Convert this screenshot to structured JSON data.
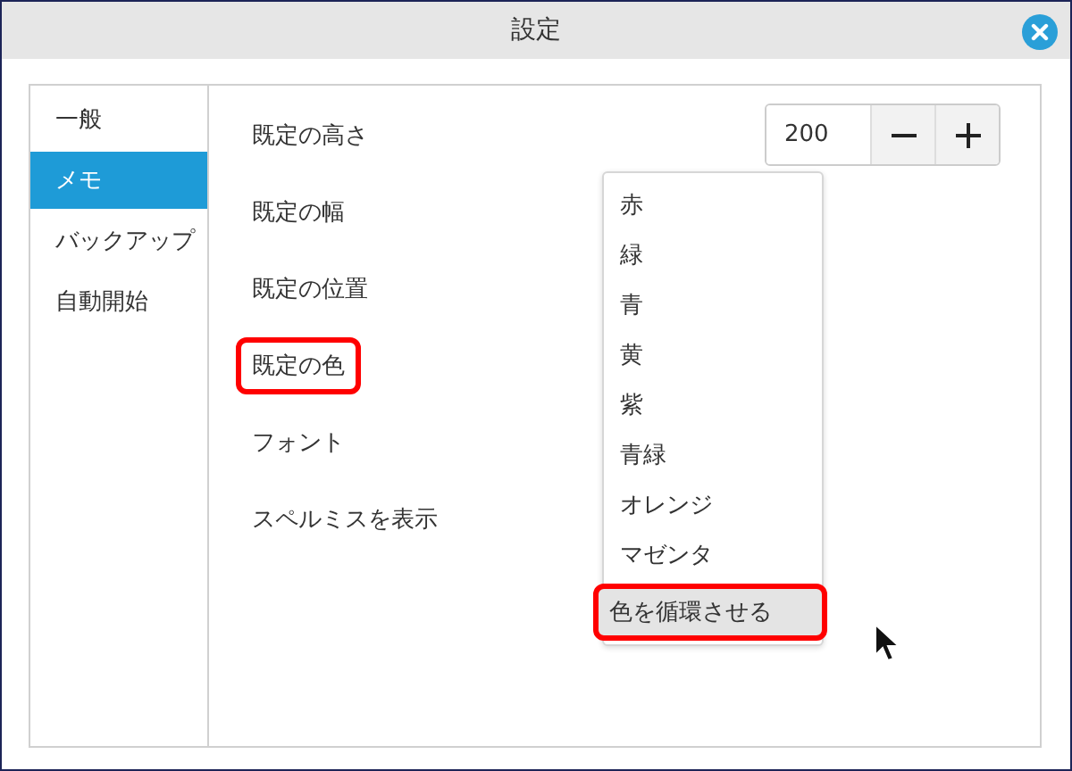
{
  "window": {
    "title": "設定"
  },
  "sidebar": {
    "items": [
      {
        "label": "一般",
        "selected": false
      },
      {
        "label": "メモ",
        "selected": true
      },
      {
        "label": "バックアップ",
        "selected": false
      },
      {
        "label": "自動開始",
        "selected": false
      }
    ]
  },
  "settings": [
    {
      "label": "既定の高さ",
      "highlighted": false
    },
    {
      "label": "既定の幅",
      "highlighted": false
    },
    {
      "label": "既定の位置",
      "highlighted": false
    },
    {
      "label": "既定の色",
      "highlighted": true
    },
    {
      "label": "フォント",
      "highlighted": false
    },
    {
      "label": "スペルミスを表示",
      "highlighted": false
    }
  ],
  "height_spinner": {
    "value": "200"
  },
  "color_menu": {
    "items": [
      {
        "label": "赤",
        "selected": false,
        "highlighted": false
      },
      {
        "label": "緑",
        "selected": false,
        "highlighted": false
      },
      {
        "label": "青",
        "selected": false,
        "highlighted": false
      },
      {
        "label": "黄",
        "selected": false,
        "highlighted": false
      },
      {
        "label": "紫",
        "selected": false,
        "highlighted": false
      },
      {
        "label": "青緑",
        "selected": false,
        "highlighted": false
      },
      {
        "label": "オレンジ",
        "selected": false,
        "highlighted": false
      },
      {
        "label": "マゼンタ",
        "selected": false,
        "highlighted": false
      },
      {
        "label": "色を循環させる",
        "selected": true,
        "highlighted": true
      }
    ]
  }
}
